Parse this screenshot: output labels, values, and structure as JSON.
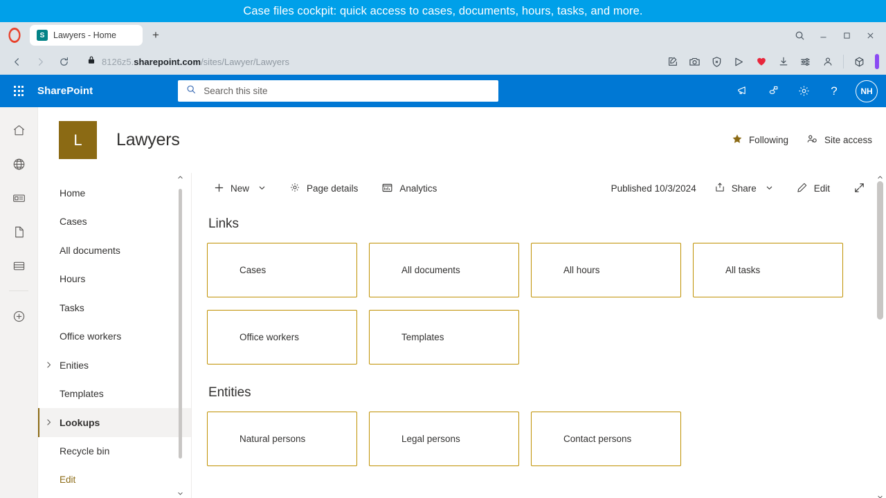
{
  "banner": {
    "text": "Case files cockpit: quick access to cases, documents, hours, tasks, and more."
  },
  "browser": {
    "name": "Opera",
    "tab": {
      "title": "Lawyers - Home",
      "favicon_letter": "S",
      "favicon_name": "sharepoint-favicon"
    },
    "new_tab_glyph": "+",
    "window_controls": {
      "search": "search-icon",
      "minimize": "minimize-icon",
      "maximize": "maximize-icon",
      "close": "close-icon"
    },
    "nav": {
      "back": "back-icon",
      "forward": "forward-icon",
      "reload": "reload-icon"
    },
    "url": {
      "lock": "lock-icon",
      "host_prefix": "8126z5.",
      "host_bold": "sharepoint.com",
      "path": "/sites/Lawyer/Lawyers"
    },
    "toolbar_icons": [
      "snapshot-edit-icon",
      "camera-icon",
      "tracker-blocker-icon",
      "flow-send-icon",
      "favorites-heart-icon",
      "downloads-icon",
      "easy-setup-icon",
      "profile-icon"
    ],
    "extension_icon": "cube-extension-icon",
    "sidebar_pill": "sidebar-toggle"
  },
  "suitebar": {
    "waffle": "app-launcher-icon",
    "brand": "SharePoint",
    "search": {
      "placeholder": "Search this site",
      "value": "",
      "icon": "search-icon"
    },
    "actions": [
      {
        "name": "megaphone-icon",
        "label": "Announcements"
      },
      {
        "name": "copilot-icon",
        "label": "Copilot"
      },
      {
        "name": "gear-icon",
        "label": "Settings"
      },
      {
        "name": "help-icon",
        "label": "?"
      }
    ],
    "avatar": {
      "initials": "NH"
    }
  },
  "apprail": [
    {
      "name": "home-icon"
    },
    {
      "name": "globe-icon"
    },
    {
      "name": "news-icon"
    },
    {
      "name": "page-icon"
    },
    {
      "name": "lists-icon"
    },
    {
      "name": "create-icon"
    }
  ],
  "site": {
    "logo_letter": "L",
    "logo_color": "#8b6a14",
    "title": "Lawyers",
    "following": {
      "label": "Following",
      "icon": "star-filled-icon"
    },
    "site_access": {
      "label": "Site access",
      "icon": "people-icon"
    }
  },
  "leftnav": {
    "items": [
      {
        "label": "Home",
        "chevron": false,
        "selected": false
      },
      {
        "label": "Cases",
        "chevron": false,
        "selected": false
      },
      {
        "label": "All documents",
        "chevron": false,
        "selected": false
      },
      {
        "label": "Hours",
        "chevron": false,
        "selected": false
      },
      {
        "label": "Tasks",
        "chevron": false,
        "selected": false
      },
      {
        "label": "Office workers",
        "chevron": false,
        "selected": false
      },
      {
        "label": "Enities",
        "chevron": true,
        "selected": false
      },
      {
        "label": "Templates",
        "chevron": false,
        "selected": false
      },
      {
        "label": "Lookups",
        "chevron": true,
        "selected": true
      },
      {
        "label": "Recycle bin",
        "chevron": false,
        "selected": false
      },
      {
        "label": "Edit",
        "chevron": false,
        "selected": false,
        "style": "edit"
      }
    ]
  },
  "commandbar": {
    "new": {
      "label": "New",
      "icon": "plus-icon",
      "chevron": "chevron-down-icon"
    },
    "page_details": {
      "label": "Page details",
      "icon": "gear-icon"
    },
    "analytics": {
      "label": "Analytics",
      "icon": "analytics-icon"
    },
    "published": "Published 10/3/2024",
    "share": {
      "label": "Share",
      "icon": "share-icon",
      "chevron": "chevron-down-icon"
    },
    "edit": {
      "label": "Edit",
      "icon": "pencil-icon"
    },
    "expand": {
      "icon": "expand-icon"
    }
  },
  "sections": [
    {
      "title": "Links",
      "cards": [
        {
          "label": "Cases"
        },
        {
          "label": "All documents"
        },
        {
          "label": "All hours"
        },
        {
          "label": "All tasks"
        },
        {
          "label": "Office workers"
        },
        {
          "label": "Templates"
        }
      ]
    },
    {
      "title": "Entities",
      "cards": [
        {
          "label": "Natural persons"
        },
        {
          "label": "Legal persons"
        },
        {
          "label": "Contact persons"
        }
      ]
    }
  ],
  "colors": {
    "accent_gold": "#bf9000",
    "sharepoint_blue": "#0078d4",
    "banner_blue": "#00a0e9"
  }
}
